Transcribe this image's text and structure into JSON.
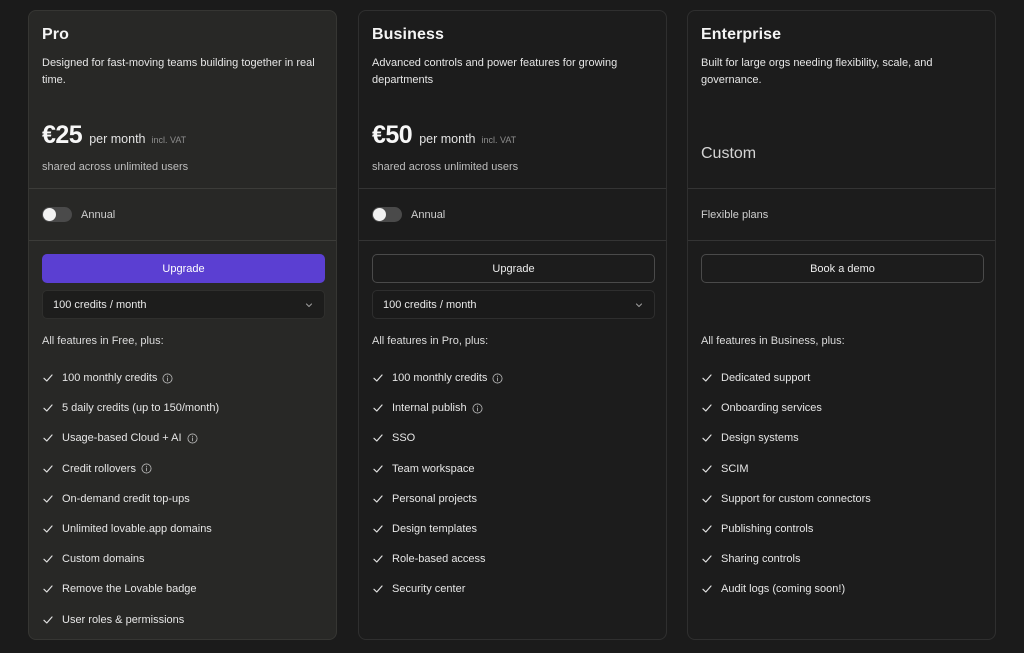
{
  "plans": {
    "pro": {
      "title": "Pro",
      "description": "Designed for fast-moving teams building together in real time.",
      "price": "€25",
      "period": "per month",
      "vat": "incl. VAT",
      "shared": "shared across unlimited users",
      "toggle_label": "Annual",
      "toggle_on": false,
      "button_label": "Upgrade",
      "credits_select": "100 credits / month",
      "features_heading": "All features in Free, plus:",
      "features": [
        {
          "label": "100 monthly credits",
          "info": true
        },
        {
          "label": "5 daily credits (up to 150/month)",
          "info": false
        },
        {
          "label": "Usage-based Cloud + AI",
          "info": true
        },
        {
          "label": "Credit rollovers",
          "info": true
        },
        {
          "label": "On-demand credit top-ups",
          "info": false
        },
        {
          "label": "Unlimited lovable.app domains",
          "info": false
        },
        {
          "label": "Custom domains",
          "info": false
        },
        {
          "label": "Remove the Lovable badge",
          "info": false
        },
        {
          "label": "User roles & permissions",
          "info": false
        }
      ]
    },
    "business": {
      "title": "Business",
      "description": "Advanced controls and power features for growing departments",
      "price": "€50",
      "period": "per month",
      "vat": "incl. VAT",
      "shared": "shared across unlimited users",
      "toggle_label": "Annual",
      "toggle_on": false,
      "button_label": "Upgrade",
      "credits_select": "100 credits / month",
      "features_heading": "All features in Pro, plus:",
      "features": [
        {
          "label": "100 monthly credits",
          "info": true
        },
        {
          "label": "Internal publish",
          "info": true
        },
        {
          "label": "SSO",
          "info": false
        },
        {
          "label": "Team workspace",
          "info": false
        },
        {
          "label": "Personal projects",
          "info": false
        },
        {
          "label": "Design templates",
          "info": false
        },
        {
          "label": "Role-based access",
          "info": false
        },
        {
          "label": "Security center",
          "info": false
        }
      ]
    },
    "enterprise": {
      "title": "Enterprise",
      "description": "Built for large orgs needing flexibility, scale, and governance.",
      "price": "Custom",
      "plans_label": "Flexible plans",
      "button_label": "Book a demo",
      "features_heading": "All features in Business, plus:",
      "features": [
        {
          "label": "Dedicated support",
          "info": false
        },
        {
          "label": "Onboarding services",
          "info": false
        },
        {
          "label": "Design systems",
          "info": false
        },
        {
          "label": "SCIM",
          "info": false
        },
        {
          "label": "Support for custom connectors",
          "info": false
        },
        {
          "label": "Publishing controls",
          "info": false
        },
        {
          "label": "Sharing controls",
          "info": false
        },
        {
          "label": "Audit logs (coming soon!)",
          "info": false
        }
      ]
    }
  },
  "colors": {
    "page_bg": "#1b1b1b",
    "highlight_card_bg": "#282826",
    "primary_button": "#5b3fd2"
  },
  "icons": {
    "feature_check": "check-icon",
    "feature_info": "info-icon",
    "select_chevron": "chevron-down-icon"
  }
}
